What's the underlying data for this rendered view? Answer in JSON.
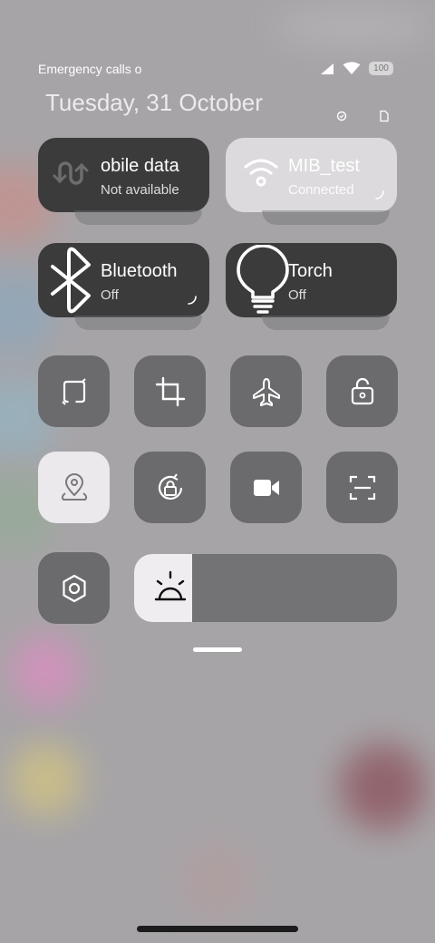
{
  "status": {
    "carrier_text": "Emergency calls o",
    "battery": "100"
  },
  "date": "Tuesday, 31 October",
  "tiles": {
    "mobile_data": {
      "title": "obile data",
      "subtitle": "Not available"
    },
    "wifi": {
      "title": "MIB_test",
      "subtitle": "Connected"
    },
    "bluetooth": {
      "title": "Bluetooth",
      "subtitle": "Off"
    },
    "torch": {
      "title": "Torch",
      "subtitle": "Off"
    }
  },
  "toggles": [
    {
      "name": "auto-rotate",
      "icon": "rotate-icon",
      "active": false
    },
    {
      "name": "screenshot-crop",
      "icon": "crop-icon",
      "active": false
    },
    {
      "name": "airplane-mode",
      "icon": "airplane-icon",
      "active": false
    },
    {
      "name": "app-lock",
      "icon": "lock-rotate-icon",
      "active": false
    },
    {
      "name": "location",
      "icon": "location-icon",
      "active": true
    },
    {
      "name": "rotation-lock",
      "icon": "rotation-lock-icon",
      "active": false
    },
    {
      "name": "screen-record",
      "icon": "video-icon",
      "active": false
    },
    {
      "name": "scan",
      "icon": "scan-icon",
      "active": false
    },
    {
      "name": "settings",
      "icon": "gear-icon",
      "active": false
    }
  ],
  "brightness": {
    "level": 0.22,
    "icon": "sun-icon"
  },
  "colors": {
    "tile_dark": "#3c3b3c",
    "tile_light": "#dcdadc",
    "toggle": "#6b6a6c",
    "toggle_active": "#ebe9eb",
    "background": "#a7a4a7"
  }
}
